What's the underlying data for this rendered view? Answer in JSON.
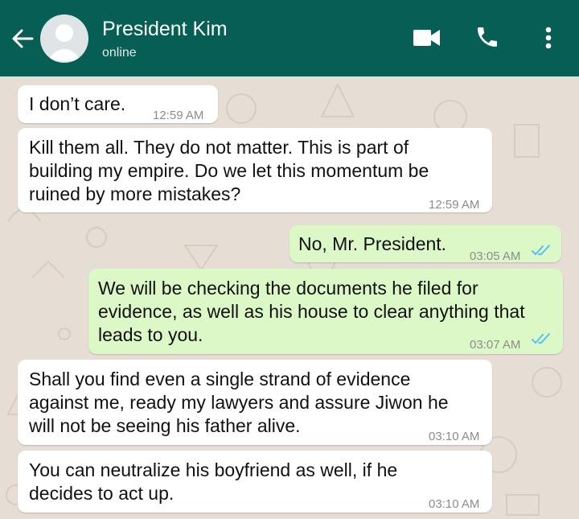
{
  "header": {
    "contact_name": "President Kim",
    "status": "online",
    "icons": [
      "back-arrow-icon",
      "avatar-placeholder-icon",
      "video-call-icon",
      "phone-icon",
      "more-options-icon"
    ],
    "colors": {
      "bar": "#075e54",
      "incoming": "#ffffff",
      "outgoing": "#dcf8c6",
      "read_ticks": "#4fc3f7"
    }
  },
  "messages": [
    {
      "direction": "incoming",
      "text": "I don’t care.",
      "time": "12:59 AM"
    },
    {
      "direction": "incoming",
      "lines": [
        "Kill them all. They do not matter. This is part of",
        "building my empire. Do we let this momentum be",
        "ruined by more mistakes?"
      ],
      "time": "12:59 AM"
    },
    {
      "direction": "outgoing",
      "text": "No, Mr. President.",
      "time": "03:05 AM",
      "status": "read"
    },
    {
      "direction": "outgoing",
      "lines": [
        "We will be checking the documents he filed for",
        "evidence, as well as his house to clear anything that",
        "leads to you."
      ],
      "time": "03:07 AM",
      "status": "read"
    },
    {
      "direction": "incoming",
      "lines": [
        "Shall you find even a single strand of evidence",
        "against me, ready my lawyers and assure Jiwon he",
        "will not be seeing his father alive."
      ],
      "time": "03:10 AM"
    },
    {
      "direction": "incoming",
      "lines": [
        "You can neutralize his boyfriend as well, if he",
        "decides to act up."
      ],
      "time": "03:10 AM"
    }
  ]
}
